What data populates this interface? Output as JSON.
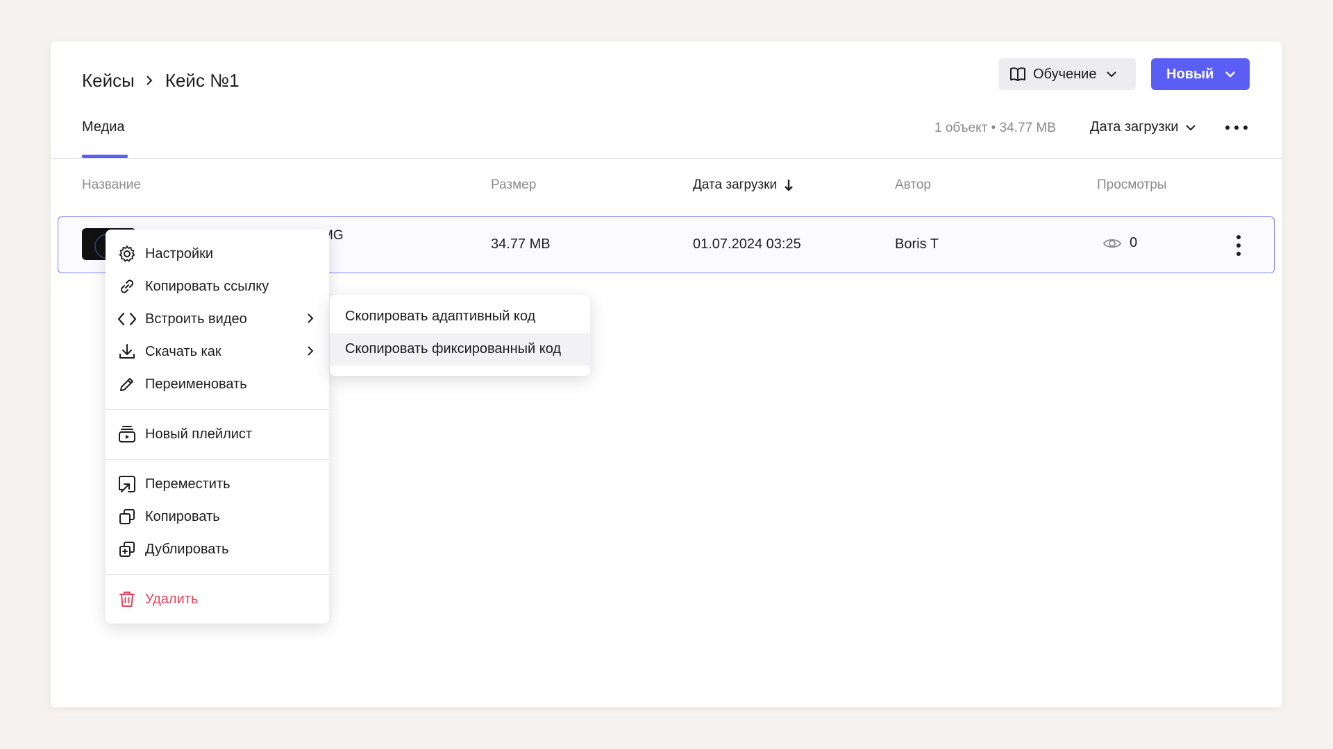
{
  "breadcrumb": {
    "root": "Кейсы",
    "current": "Кейс №1"
  },
  "header": {
    "learn_label": "Обучение",
    "new_label": "Новый"
  },
  "tabs": [
    {
      "label": "Медиа",
      "active": true
    }
  ],
  "toolbar": {
    "count_text": "1 объект • 34.77 MB",
    "sort_label": "Дата загрузки"
  },
  "table": {
    "headers": {
      "name": "Название",
      "size": "Размер",
      "date": "Дата загрузки",
      "author": "Автор",
      "views": "Просмотры"
    },
    "rows": [
      {
        "name_visible": "MG",
        "size": "34.77 MB",
        "date": "01.07.2024 03:25",
        "author": "Boris T",
        "views": "0"
      }
    ]
  },
  "context_menu": {
    "items": [
      {
        "label": "Настройки",
        "icon": "gear-icon"
      },
      {
        "label": "Копировать ссылку",
        "icon": "link-icon"
      },
      {
        "label": "Встроить видео",
        "icon": "code-icon",
        "submenu": true
      },
      {
        "label": "Скачать как",
        "icon": "download-icon",
        "submenu": true
      },
      {
        "label": "Переименовать",
        "icon": "pencil-icon"
      },
      {
        "label": "Новый плейлист",
        "icon": "playlist-icon"
      },
      {
        "label": "Переместить",
        "icon": "move-icon"
      },
      {
        "label": "Копировать",
        "icon": "copy-icon"
      },
      {
        "label": "Дублировать",
        "icon": "duplicate-icon"
      },
      {
        "label": "Удалить",
        "icon": "trash-icon",
        "danger": true
      }
    ]
  },
  "submenu": {
    "items": [
      {
        "label": "Скопировать адаптивный код"
      },
      {
        "label": "Скопировать фиксированный код",
        "hovered": true
      }
    ]
  },
  "colors": {
    "accent": "#5b5ef4",
    "danger": "#e9435a",
    "background": "#f5f2ef",
    "muted_text": "#8a8a8e"
  }
}
